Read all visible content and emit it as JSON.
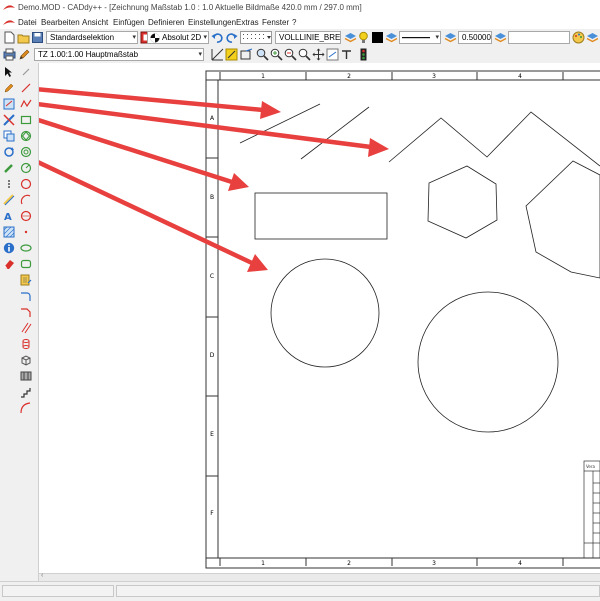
{
  "window": {
    "title": "Demo.MOD  -  CADdy++ - [Zeichnung   Maßstab 1.0 : 1.0   Aktuelle Bildmaße 420.0 mm / 297.0 mm]"
  },
  "menu": [
    "Datei",
    "Bearbeiten",
    "Ansicht",
    "Einfügen",
    "Definieren",
    "Einstellungen",
    "Extras",
    "Fenster",
    "?"
  ],
  "toolbar": {
    "selection_mode": "Standardselektion",
    "view_mode": "Absolut 2D",
    "line_style": "VOLLLINIE_BREIT",
    "line_width": "0.500000",
    "empty_field": "",
    "scale_combo": "TZ 1.00:1.00 Hauptmaßstab"
  },
  "drawing": {
    "ruler_numbers": [
      "1",
      "2",
      "3",
      "4"
    ],
    "ruler_letters": [
      "A",
      "B",
      "C",
      "D",
      "E",
      "F"
    ],
    "title_block_label": "Vera"
  },
  "colors": {
    "arrow": "#e8403e",
    "accent_red": "#d9302b",
    "accent_blue": "#2a6fc9",
    "accent_green": "#3c9a3c"
  }
}
